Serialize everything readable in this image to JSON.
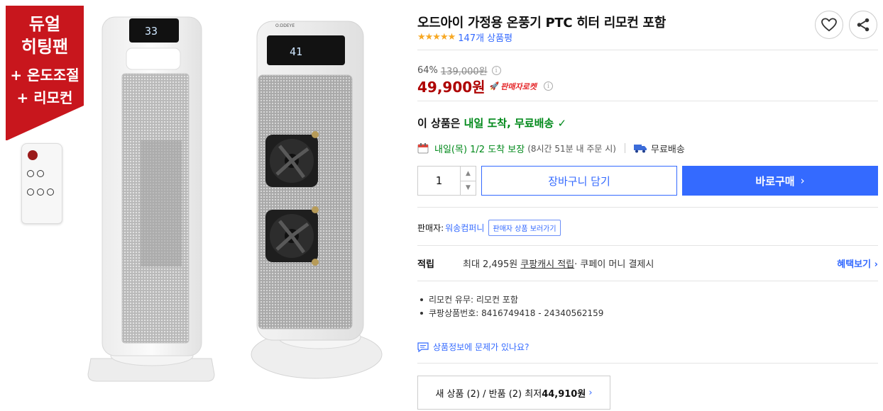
{
  "gallery": {
    "badge_lines": [
      "듀얼",
      "히팅팬",
      "+ 온도조절",
      "+ 리모컨"
    ],
    "heater1_display": "33",
    "heater2_display": "41",
    "heater2_brand": "O:DDEYE"
  },
  "product": {
    "title": "오드아이 가정용 온풍기 PTC 히터 리모컨 포함",
    "stars": "★★★★★",
    "review_count": "147개 상품평"
  },
  "price": {
    "discount_rate": "64%",
    "original_price": "139,000원",
    "sale_price": "49,900원",
    "rocket_label": "판매자로켓",
    "info_glyph": "i"
  },
  "delivery": {
    "headline_prefix": "이 상품은 ",
    "headline_highlight": "내일 도착, 무료배송",
    "headline_check": "✓",
    "arrival": "내일(목) 1/2 도착 보장",
    "cutoff": "(8시간 51분 내 주문 시)",
    "free_shipping": "무료배송"
  },
  "purchase": {
    "quantity": "1",
    "qty_up": "▲",
    "qty_down": "▼",
    "cart_label": "장바구니 담기",
    "buy_label": "바로구매",
    "buy_chevron": "›"
  },
  "seller": {
    "label": "판매자:",
    "name": "워송컴퍼니",
    "link_label": "판매자 상품 보러가기"
  },
  "points": {
    "label": "적립",
    "text_before": "최대 2,495원",
    "cash_link": "쿠팡캐시 적립",
    "text_after": " · 쿠페이 머니 결제시",
    "more_label": "혜택보기 ›"
  },
  "specs": [
    "리모컨 유무: 리모컨 포함",
    "쿠팡상품번호: 8416749418 - 24340562159"
  ],
  "report": {
    "label": "상품정보에 문제가 있나요?"
  },
  "other_sellers": {
    "text_prefix": "새 상품 (2) / 반품 (2) 최저 ",
    "lowest_price": "44,910원",
    "chevron": "›"
  },
  "colors": {
    "accent_blue": "#346aff",
    "price_red": "#ae0000",
    "delivery_green": "#00891a",
    "badge_red": "#c8161d",
    "star_orange": "#f7a823"
  }
}
